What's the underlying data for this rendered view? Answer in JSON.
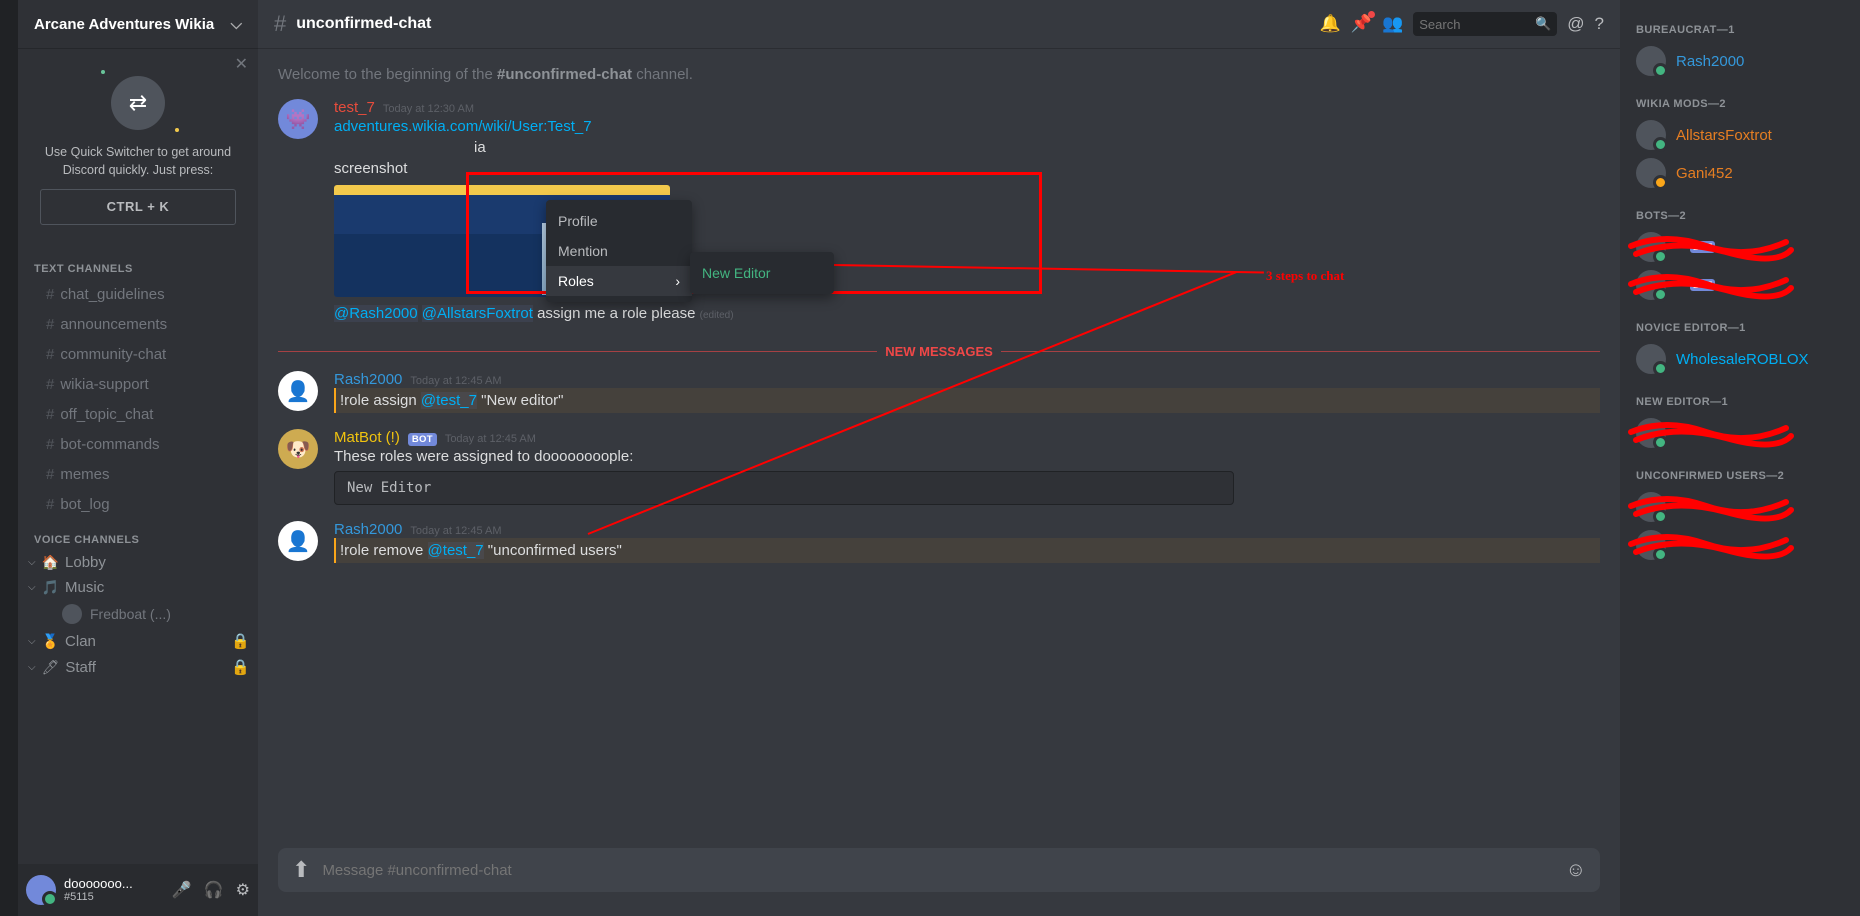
{
  "server": {
    "name": "Arcane Adventures Wikia"
  },
  "quickSwitcher": {
    "text1": "Use Quick Switcher to get around",
    "text2": "Discord quickly. Just press:",
    "key": "CTRL + K"
  },
  "channels": {
    "textHeading": "TEXT CHANNELS",
    "voiceHeading": "VOICE CHANNELS",
    "text": [
      {
        "name": "chat_guidelines"
      },
      {
        "name": "announcements"
      },
      {
        "name": "community-chat"
      },
      {
        "name": "wikia-support"
      },
      {
        "name": "off_topic_chat"
      },
      {
        "name": "bot-commands"
      },
      {
        "name": "memes"
      },
      {
        "name": "bot_log"
      }
    ],
    "voice": [
      {
        "name": "Lobby",
        "emoji": "🏠"
      },
      {
        "name": "Music",
        "emoji": "🎵",
        "expanded": true,
        "users": [
          {
            "name": "Fredboat (...)"
          }
        ]
      },
      {
        "name": "Clan",
        "emoji": "🏅",
        "locked": true
      },
      {
        "name": "Staff",
        "emoji": "🖊",
        "locked": true
      }
    ]
  },
  "userPanel": {
    "name": "dooooooo...",
    "disc": "#5115"
  },
  "titleBar": {
    "channel": "unconfirmed-chat",
    "searchPlaceholder": "Search"
  },
  "welcome": {
    "pre": "Welcome to the beginning of the ",
    "chan": "#unconfirmed-chat",
    "post": " channel."
  },
  "messages": {
    "m1": {
      "user": "test_7",
      "time": "Today at 12:30 AM",
      "link": "adventures.wikia.com/wiki/User:Test_7",
      "mid": "ia",
      "screenshot": "screenshot",
      "mention1": "@Rash2000",
      "mention2": "@AllstarsFoxtrot",
      "after": " assign me a role please ",
      "edited": "(edited)"
    },
    "divider": "NEW MESSAGES",
    "m2": {
      "user": "Rash2000",
      "time": "Today at 12:45 AM",
      "pre": "!role assign ",
      "mention": "@test_7",
      "post": " \"New editor\""
    },
    "m3": {
      "user": "MatBot (!)",
      "bot": "BOT",
      "time": "Today at 12:45 AM",
      "text": "These roles were assigned to doooooooople:",
      "code": "New Editor"
    },
    "m4": {
      "user": "Rash2000",
      "time": "Today at 12:45 AM",
      "pre": "!role remove ",
      "mention": "@test_7",
      "post": " \"unconfirmed users\""
    }
  },
  "contextMenu": {
    "profile": "Profile",
    "mention": "Mention",
    "roles": "Roles",
    "newEditor": "New Editor"
  },
  "annotation": "3 steps to chat",
  "input": {
    "placeholder": "Message #unconfirmed-chat"
  },
  "members": {
    "groups": [
      {
        "head": "BUREAUCRAT—1",
        "items": [
          {
            "name": "Rash2000",
            "cls": "c-blue"
          }
        ]
      },
      {
        "head": "WIKIA MODS—2",
        "items": [
          {
            "name": "AllstarsFoxtrot",
            "cls": "c-orange"
          },
          {
            "name": "Gani452",
            "cls": "c-orange",
            "idle": true
          }
        ]
      },
      {
        "head": "BOTS—2",
        "items": [
          {
            "name": "",
            "bot": true,
            "scribble": true
          },
          {
            "name": "",
            "bot": true,
            "scribble": true
          }
        ]
      },
      {
        "head": "NOVICE EDITOR—1",
        "items": [
          {
            "name": "WholesaleROBLOX",
            "cls": "c-cyan"
          }
        ]
      },
      {
        "head": "NEW EDITOR—1",
        "items": [
          {
            "name": "",
            "scribble": true
          }
        ]
      },
      {
        "head": "UNCONFIRMED USERS—2",
        "items": [
          {
            "name": "",
            "scribble": true
          },
          {
            "name": "",
            "scribble": true
          }
        ]
      }
    ]
  }
}
